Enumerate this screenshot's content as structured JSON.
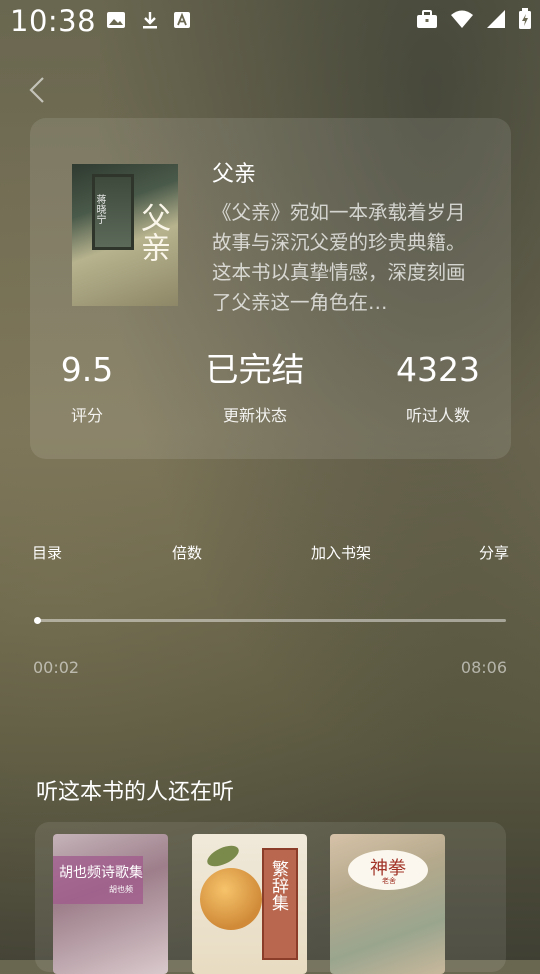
{
  "status_bar": {
    "time": "10:38",
    "left_icons": [
      "image-icon",
      "download-icon",
      "font-icon"
    ],
    "right_icons": [
      "briefcase-icon",
      "wifi-icon",
      "signal-icon",
      "battery-icon"
    ]
  },
  "book": {
    "cover_title": "父亲",
    "cover_side": "蒋晓宁",
    "title": "父亲",
    "description": "《父亲》宛如一本承载着岁月故事与深沉父爱的珍贵典籍。这本书以真挚情感，深度刻画了父亲这一角色在…",
    "stats": [
      {
        "value": "9.5",
        "label": "评分"
      },
      {
        "value": "已完结",
        "label": "更新状态"
      },
      {
        "value": "4323",
        "label": "听过人数"
      }
    ]
  },
  "actions": {
    "catalog": "目录",
    "speed": "倍数",
    "add_shelf": "加入书架",
    "share": "分享"
  },
  "player": {
    "current_time": "00:02",
    "total_time": "08:06",
    "progress": 0.004
  },
  "recommend": {
    "heading": "听这本书的人还在听",
    "books": [
      {
        "cover_text": "胡也频诗歌集",
        "cover_sub": "胡也频"
      },
      {
        "cover_text": "繁辞集"
      },
      {
        "cover_text": "神拳",
        "cover_sub": "老舍"
      }
    ]
  }
}
